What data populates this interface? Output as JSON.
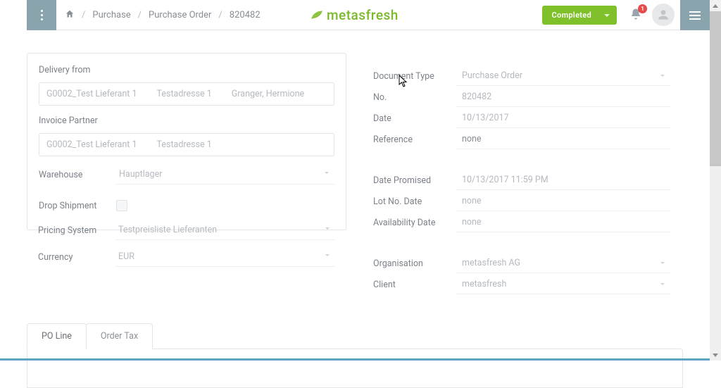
{
  "header": {
    "breadcrumb": {
      "item1": "Purchase",
      "item2": "Purchase Order",
      "item3": "820482"
    },
    "logo_text": "metasfresh",
    "status_button": "Completed",
    "notification_count": "1"
  },
  "left": {
    "delivery_from_label": "Delivery from",
    "delivery_from": {
      "partner": "G0002_Test Lieferant 1",
      "address": "Testadresse 1",
      "contact": "Granger, Hermione"
    },
    "invoice_partner_label": "Invoice Partner",
    "invoice_partner": {
      "partner": "G0002_Test Lieferant 1",
      "address": "Testadresse 1"
    },
    "warehouse_label": "Warehouse",
    "warehouse_value": "Hauptlager",
    "drop_shipment_label": "Drop Shipment",
    "pricing_system_label": "Pricing System",
    "pricing_system_value": "Testpreisliste Lieferanten",
    "currency_label": "Currency",
    "currency_value": "EUR"
  },
  "right": {
    "doc_type_label": "Document Type",
    "doc_type_value": "Purchase Order",
    "no_label": "No.",
    "no_value": "820482",
    "date_label": "Date",
    "date_value": "10/13/2017",
    "reference_label": "Reference",
    "reference_value": "none",
    "date_promised_label": "Date Promised",
    "date_promised_value": "10/13/2017 11:59 PM",
    "lot_no_date_label": "Lot No. Date",
    "lot_no_date_value": "none",
    "availability_date_label": "Availability Date",
    "availability_date_value": "none",
    "organisation_label": "Organisation",
    "organisation_value": "metasfresh AG",
    "client_label": "Client",
    "client_value": "metasfresh"
  },
  "tabs": {
    "tab1": "PO Line",
    "tab2": "Order Tax"
  }
}
